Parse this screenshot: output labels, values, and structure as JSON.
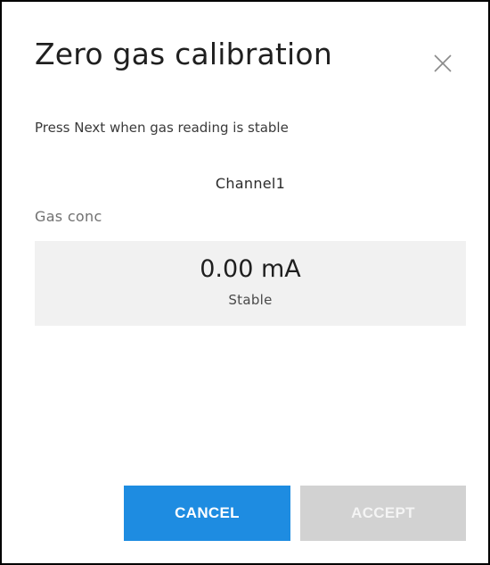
{
  "dialog": {
    "title": "Zero gas calibration",
    "close_icon": "close-icon",
    "instruction": "Press Next when gas reading is stable",
    "channel_name": "Channel1",
    "measurement_label": "Gas conc",
    "reading": {
      "value": "0.00 mA",
      "status": "Stable"
    },
    "buttons": {
      "cancel_label": "CANCEL",
      "accept_label": "ACCEPT",
      "accept_enabled": false
    }
  },
  "colors": {
    "primary_button": "#1e8ce1",
    "disabled_button": "#d2d2d2",
    "reading_background": "#f1f1f1"
  }
}
